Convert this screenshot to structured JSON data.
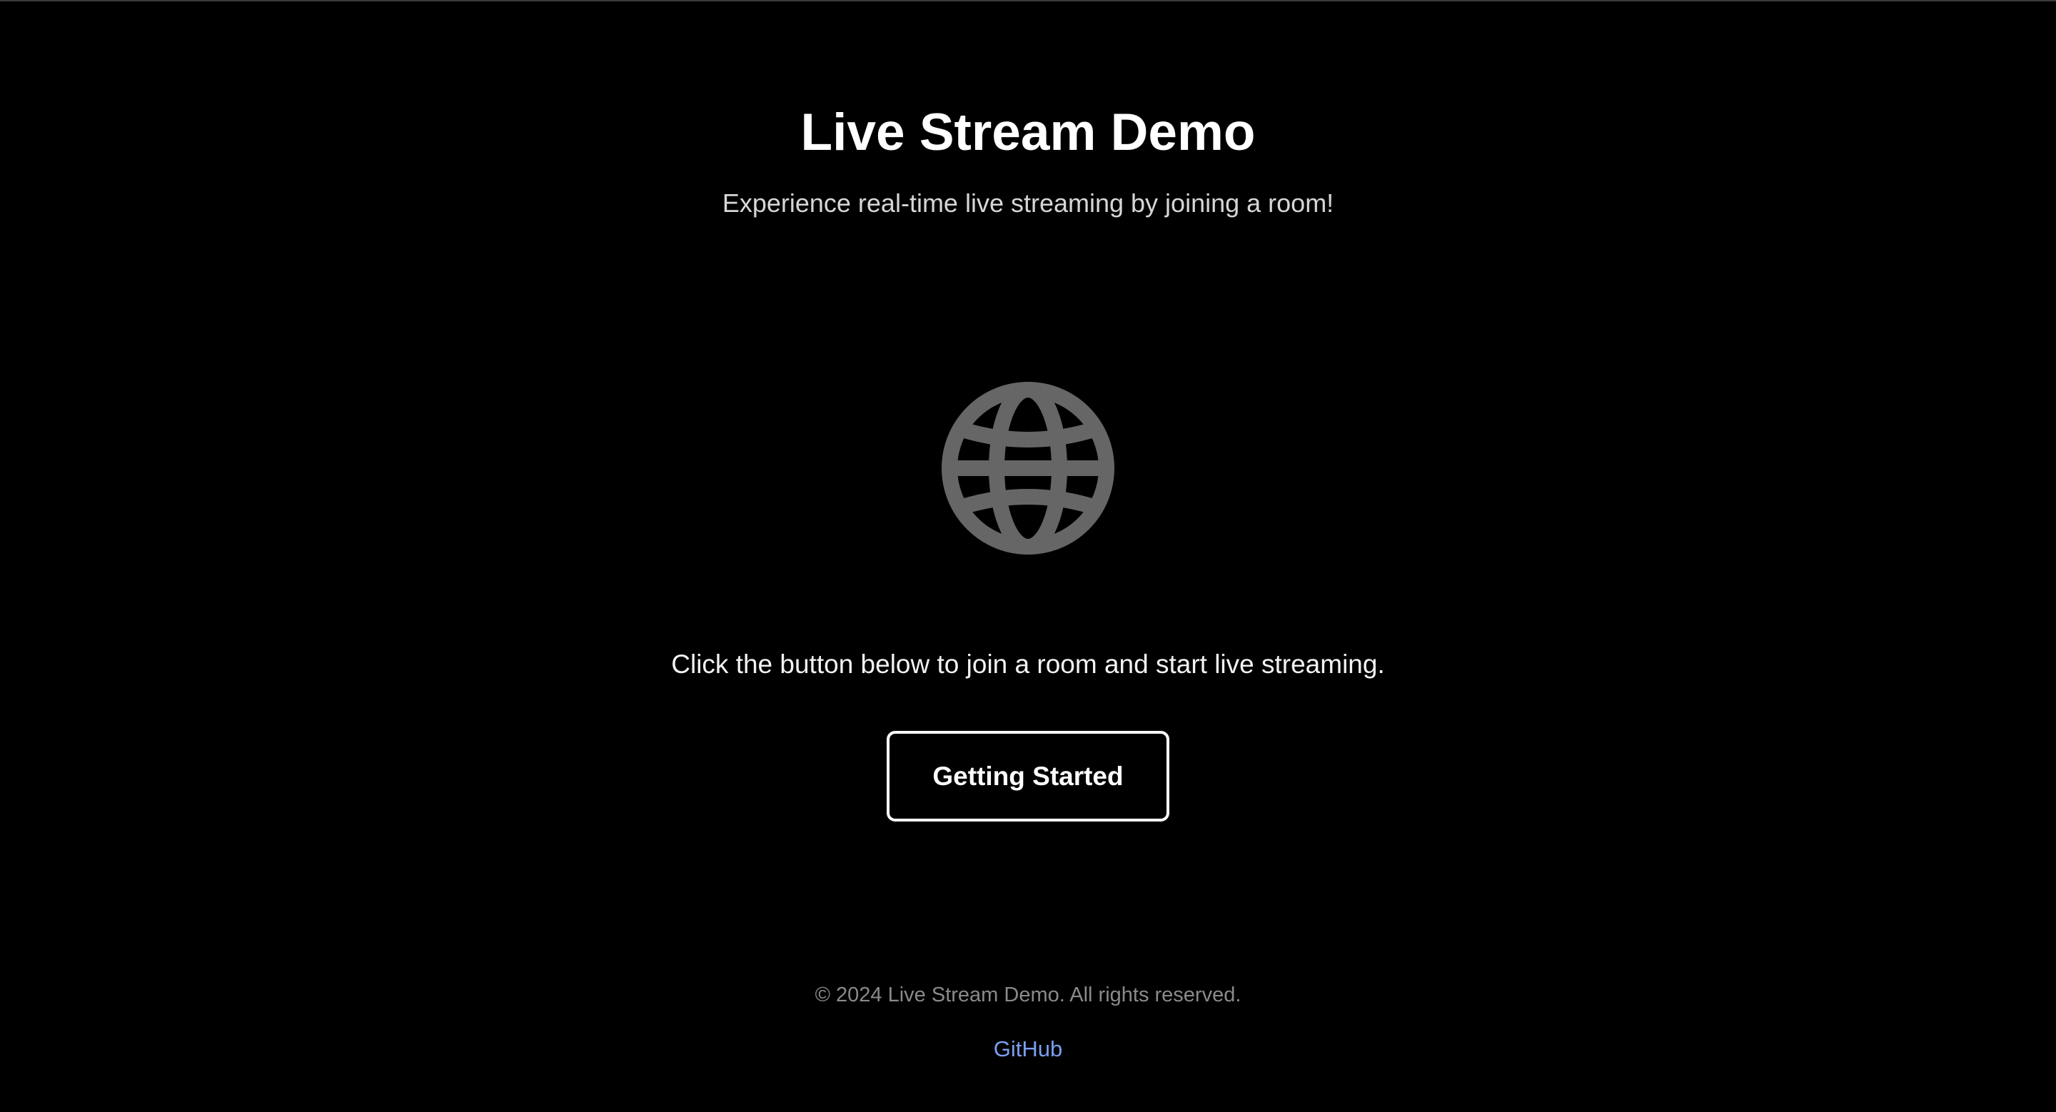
{
  "header": {
    "title": "Live Stream Demo",
    "subtitle": "Experience real-time live streaming by joining a room!"
  },
  "hero": {
    "icon": "globe-icon",
    "icon_color": "#666666"
  },
  "main": {
    "instruction": "Click the button below to join a room and start live streaming.",
    "cta_label": "Getting Started"
  },
  "footer": {
    "copyright": "© 2024 Live Stream Demo. All rights reserved.",
    "link_label": "GitHub",
    "link_color": "#7b9ff0"
  }
}
